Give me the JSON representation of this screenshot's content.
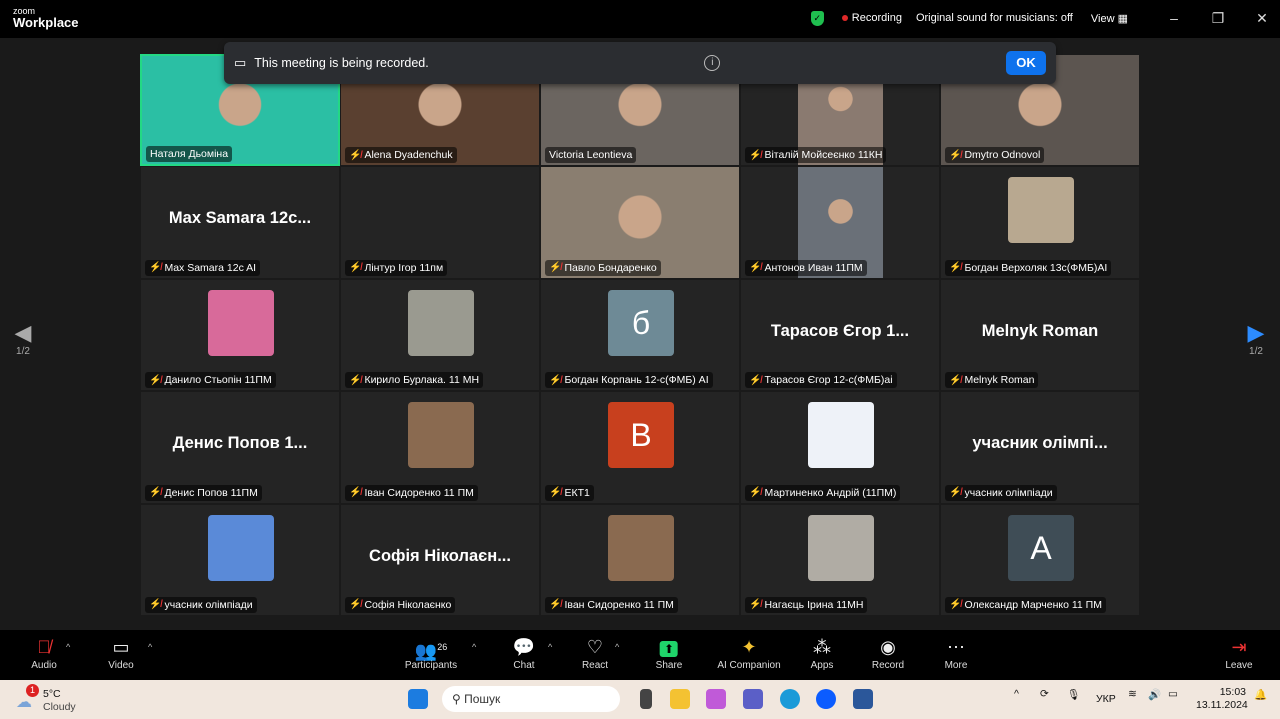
{
  "titlebar": {
    "logo_small": "zoom",
    "logo_big": "Workplace",
    "recording": "Recording",
    "original_sound": "Original sound for musicians: off",
    "view": "View"
  },
  "banner": {
    "message": "This meeting is being recorded.",
    "ok": "OK"
  },
  "pager": {
    "left": "1/2",
    "right": "1/2"
  },
  "tiles": [
    {
      "name": "Наталя Дьоміна",
      "type": "video",
      "color": "#2bbfa4",
      "muted": false,
      "active": true
    },
    {
      "name": "Alena Dyadenchuk",
      "type": "video",
      "color": "#5a4030",
      "muted": true
    },
    {
      "name": "Victoria Leontieva",
      "type": "video",
      "color": "#6b6560",
      "muted": false
    },
    {
      "name": "Віталій Мойсеєнко 11КН",
      "type": "portrait",
      "color": "#8a7a70",
      "muted": true
    },
    {
      "name": "Dmytro Odnovol",
      "type": "video",
      "color": "#5c5550",
      "muted": true
    },
    {
      "name": "Max Samara 12c AI",
      "type": "text",
      "label": "Max Samara 12c...",
      "muted": true
    },
    {
      "name": "Лінтур Ігор 11пм",
      "type": "blank",
      "muted": true
    },
    {
      "name": "Павло Бондаренко",
      "type": "video",
      "color": "#8a7e70",
      "muted": true
    },
    {
      "name": "Антонов Иван 11ПМ",
      "type": "portrait",
      "color": "#6a7078",
      "muted": true
    },
    {
      "name": "Богдан Верхоляк 13с(ФМБ)AI",
      "type": "avatar",
      "color": "#b8a890",
      "muted": true
    },
    {
      "name": "Данило Стьопін 11ПМ",
      "type": "avatar",
      "color": "#d86a9a",
      "muted": true
    },
    {
      "name": "Кирило Бурлака. 11 МН",
      "type": "avatar",
      "color": "#9a9a90",
      "muted": true
    },
    {
      "name": "Богдан Корпань 12-с(ФМБ) AI",
      "type": "letter",
      "label": "б",
      "color": "#6e8a96",
      "muted": true
    },
    {
      "name": "Тарасов Єгор 12-с(ФМБ)ai",
      "type": "text",
      "label": "Тарасов Єгор 1...",
      "muted": true
    },
    {
      "name": "Melnyk Roman",
      "type": "text",
      "label": "Melnyk Roman",
      "muted": true
    },
    {
      "name": "Денис Попов 11ПМ",
      "type": "text",
      "label": "Денис Попов 1...",
      "muted": true
    },
    {
      "name": "Іван Сидоренко 11 ПМ",
      "type": "avatar",
      "color": "#8a6a50",
      "muted": true
    },
    {
      "name": "ЕКТ1",
      "type": "letter",
      "label": "B",
      "color": "#c8401e",
      "muted": true
    },
    {
      "name": "Мартиненко Андрій (11ПМ)",
      "type": "avatar",
      "color": "#eef2f8",
      "muted": true
    },
    {
      "name": "учасник олімпіади",
      "type": "text",
      "label": "учасник олімпі...",
      "muted": true
    },
    {
      "name": "учасник олімпіади",
      "type": "avatar",
      "color": "#5a8ad8",
      "muted": true
    },
    {
      "name": "Софія Ніколаєнко",
      "type": "text",
      "label": "Софія Ніколаєн...",
      "muted": true
    },
    {
      "name": "Іван Сидоренко 11 ПМ",
      "type": "avatar",
      "color": "#8a6a50",
      "muted": true
    },
    {
      "name": "Нагаєць Ірина 11МН",
      "type": "avatar",
      "color": "#b0aca4",
      "muted": true
    },
    {
      "name": "Олександр Марченко 11 ПМ",
      "type": "letter",
      "label": "A",
      "color": "#3f4d56",
      "muted": true
    }
  ],
  "toolbar": {
    "audio": "Audio",
    "video": "Video",
    "participants": "Participants",
    "participants_count": "26",
    "chat": "Chat",
    "react": "React",
    "share": "Share",
    "ai": "AI Companion",
    "apps": "Apps",
    "record": "Record",
    "more": "More",
    "leave": "Leave"
  },
  "taskbar": {
    "weather_badge": "1",
    "temp": "5°C",
    "weather": "Cloudy",
    "search_placeholder": "Пошук",
    "lang": "УКР",
    "time": "15:03",
    "date": "13.11.2024"
  }
}
